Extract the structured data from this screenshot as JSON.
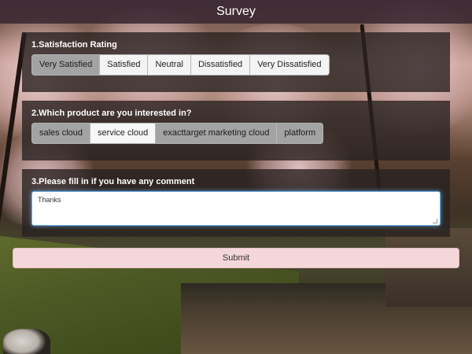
{
  "header": {
    "title": "Survey"
  },
  "q1": {
    "title": "1.Satisfaction Rating",
    "options": [
      "Very Satisfied",
      "Satisfied",
      "Neutral",
      "Dissatisfied",
      "Very Dissatisfied"
    ],
    "selected": "Very Satisfied"
  },
  "q2": {
    "title": "2.Which product are you interested in?",
    "options": [
      "sales cloud",
      "service cloud",
      "exacttarget marketing cloud",
      "platform"
    ],
    "selected": "service cloud"
  },
  "q3": {
    "title": "3.Please fill in if you have any comment",
    "comment_value": "Thanks"
  },
  "submit": {
    "label": "Submit"
  },
  "colors": {
    "header_bg": "#3a2832",
    "panel_bg": "#282220",
    "submit_bg": "#f4d7d9",
    "focus_border": "#66afe9"
  }
}
